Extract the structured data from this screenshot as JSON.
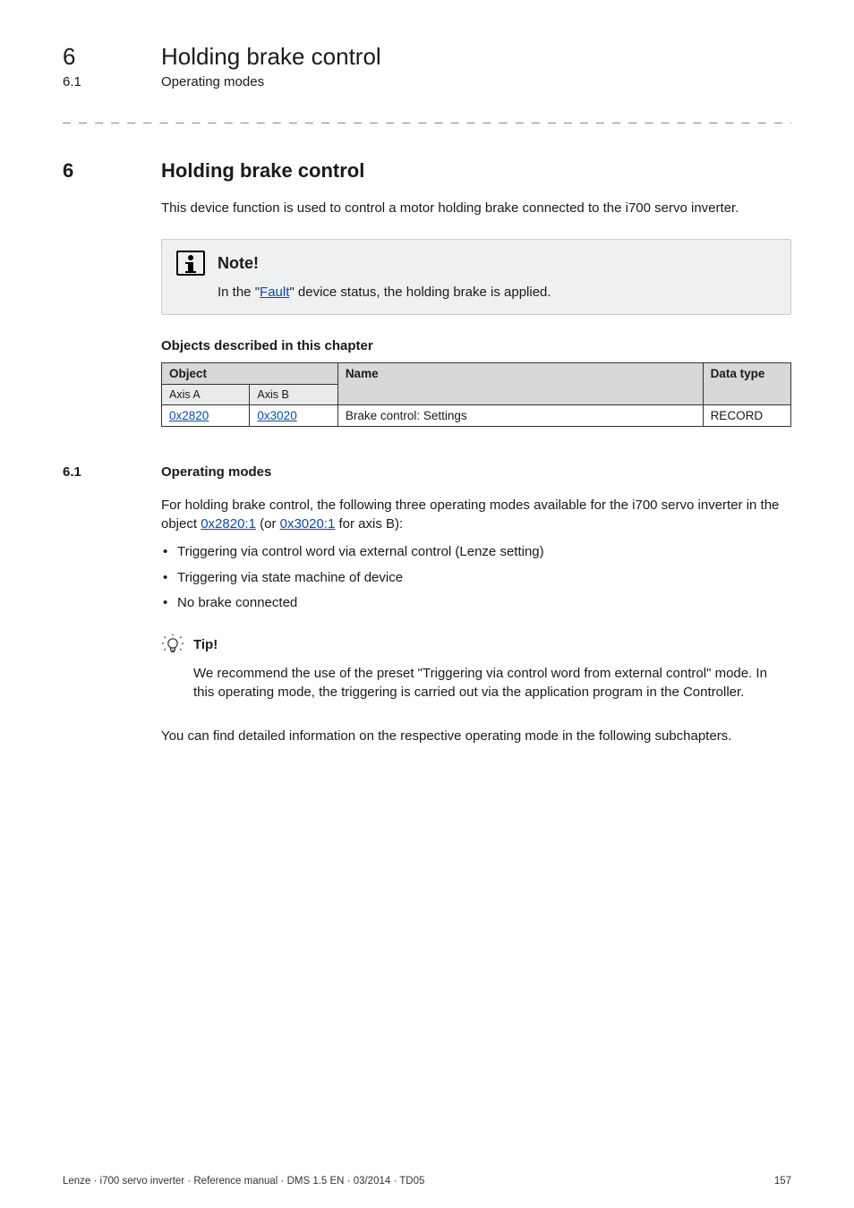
{
  "header": {
    "chapter_num": "6",
    "chapter_title": "Holding brake control",
    "section_num": "6.1",
    "section_title": "Operating modes"
  },
  "dashline": "_ _ _ _ _ _ _ _ _ _ _ _ _ _ _ _ _ _ _ _ _ _ _ _ _ _ _ _ _ _ _ _ _ _ _ _ _ _ _ _ _ _ _ _ _ _ _ _ _ _ _ _ _ _ _ _ _ _ _ _ _ _ _ _",
  "section6": {
    "num": "6",
    "title": "Holding brake control",
    "intro": "This device function is used to control a motor holding brake connected to the i700 servo inverter."
  },
  "note": {
    "title": "Note!",
    "body_pre": "In the \"",
    "link": "Fault",
    "body_post": "\" device status, the holding brake is applied."
  },
  "objects": {
    "heading": "Objects described in this chapter",
    "cols": {
      "object": "Object",
      "name": "Name",
      "datatype": "Data type",
      "axisA": "Axis A",
      "axisB": "Axis B"
    },
    "rows": [
      {
        "axisA": "0x2820",
        "axisB": "0x3020",
        "name": "Brake control: Settings",
        "datatype": "RECORD"
      }
    ]
  },
  "section61": {
    "num": "6.1",
    "title": "Operating modes",
    "para_pre": "For holding brake control, the following three operating modes available for the i700 servo inverter in the object ",
    "link1": "0x2820:1",
    "mid": " (or ",
    "link2": "0x3020:1",
    "para_post": " for axis B):",
    "bullets": [
      "Triggering via control word via external control (Lenze setting)",
      "Triggering via state machine of device",
      "No brake connected"
    ],
    "tip_label": "Tip!",
    "tip_body": "We recommend the use of the preset \"Triggering via control word from external control\" mode. In this operating mode, the triggering is carried out via the application program in the Controller.",
    "closing": "You can find detailed information on the respective operating mode in the following subchapters."
  },
  "footer": {
    "left": "Lenze · i700 servo inverter · Reference manual · DMS 1.5 EN · 03/2014 · TD05",
    "right": "157"
  }
}
